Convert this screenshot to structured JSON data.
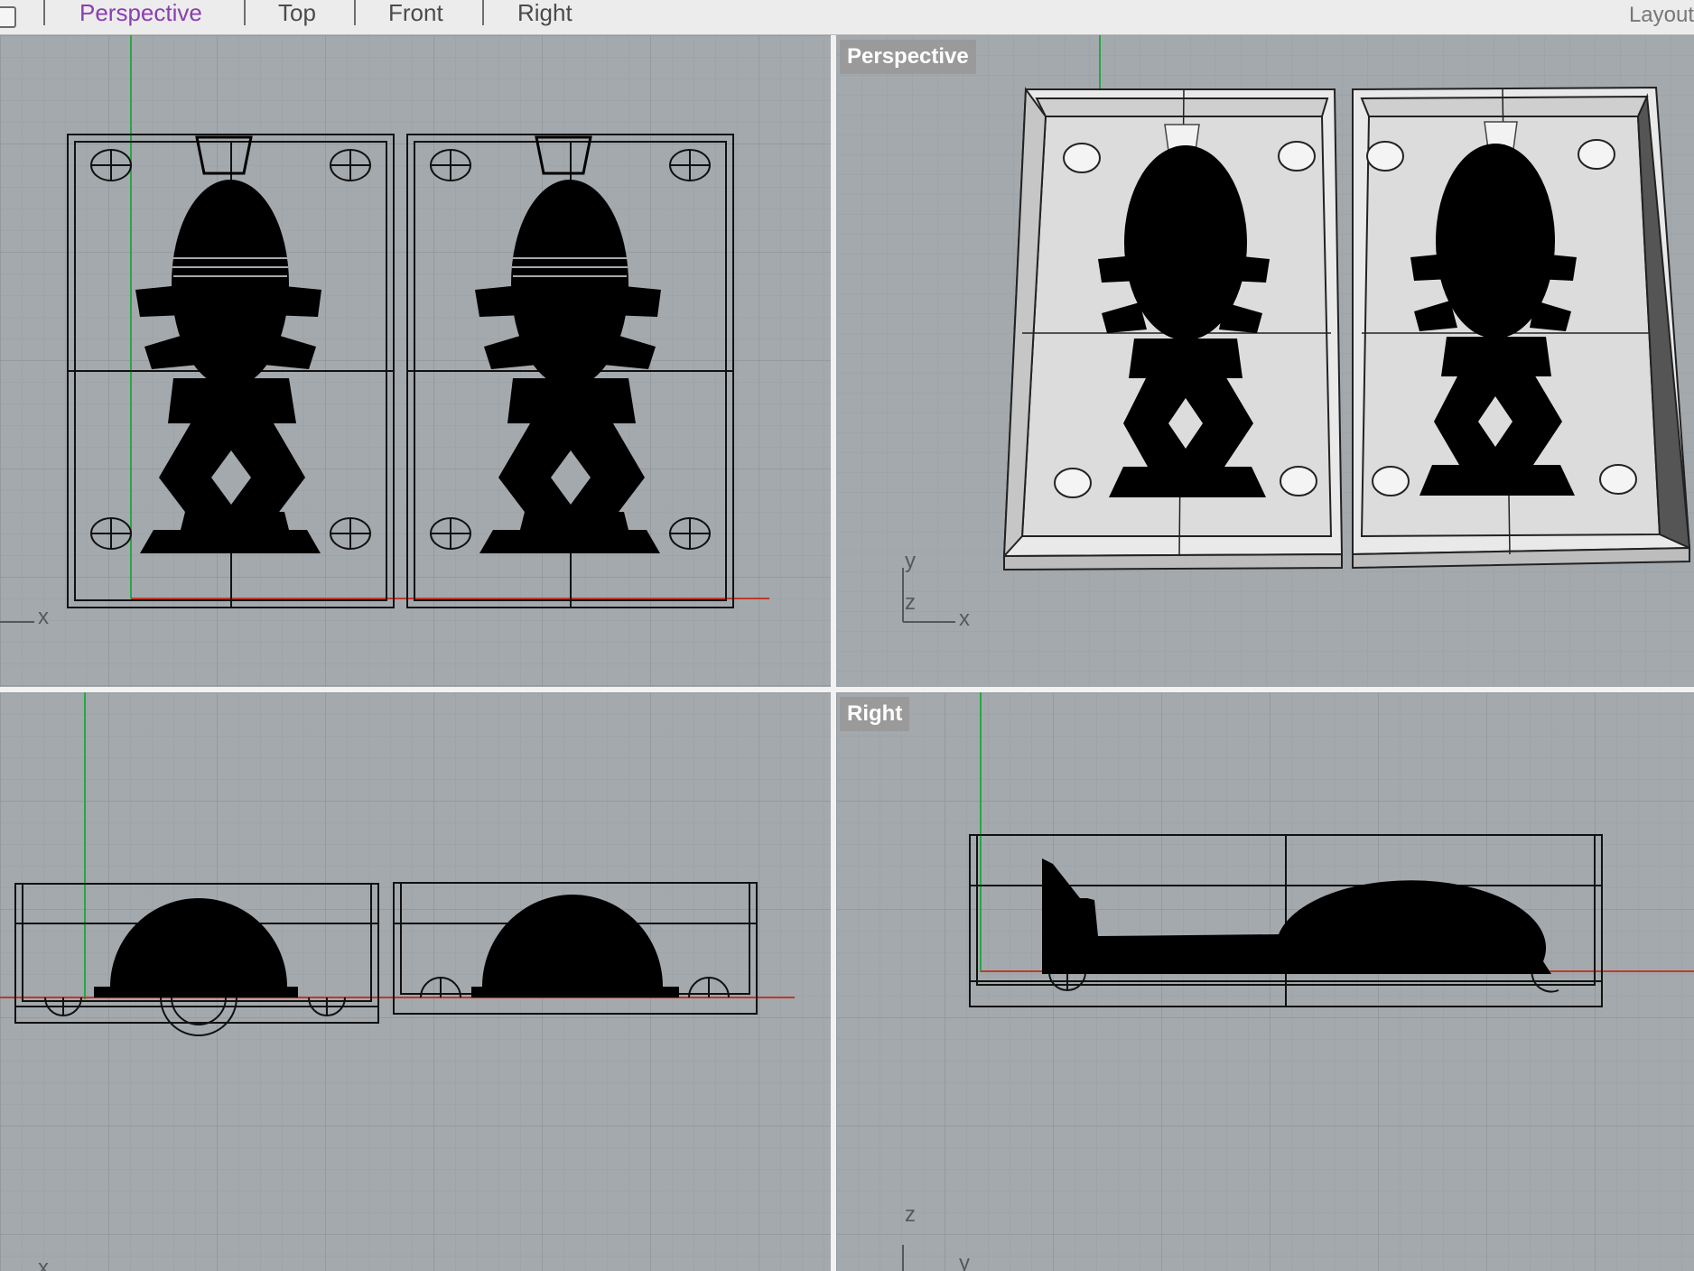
{
  "tabs": [
    {
      "label": "Perspective",
      "active": true
    },
    {
      "label": "Top",
      "active": false
    },
    {
      "label": "Front",
      "active": false
    },
    {
      "label": "Right",
      "active": false
    }
  ],
  "layout_label": "Layout",
  "viewports": {
    "top_left": {
      "label": ""
    },
    "top_right": {
      "label": "Perspective"
    },
    "bottom_left": {
      "label": ""
    },
    "bottom_right": {
      "label": "Right"
    }
  },
  "axis_labels": {
    "x": "x",
    "y": "y",
    "z": "z"
  },
  "colors": {
    "grid_bg": "#a4a9ad",
    "grid_minor": "#9aa0a5",
    "grid_major": "#8c9297",
    "axis_x": "#c0392b",
    "axis_y": "#27a745",
    "active_tab": "#8a3fb0",
    "model": "#000000",
    "mold_fill": "#e6e6e6"
  },
  "icons": {
    "tab_checkbox": "checkbox-icon"
  }
}
